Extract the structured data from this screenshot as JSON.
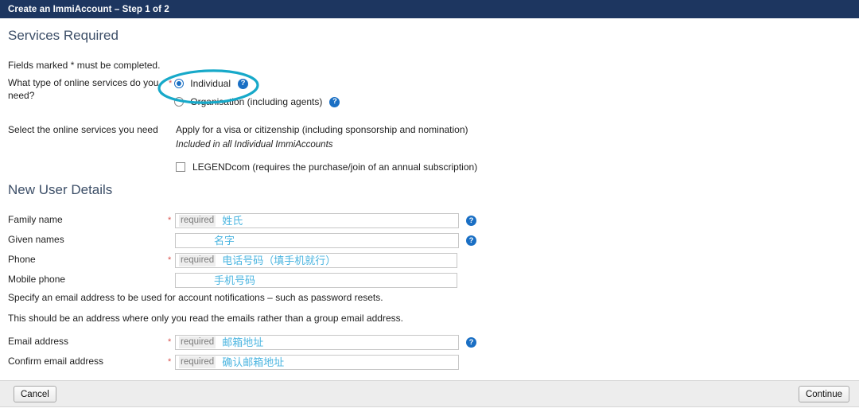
{
  "window": {
    "step_header": "Create an ImmiAccount – Step 1 of 2"
  },
  "services_section": {
    "heading": "Services Required",
    "fields_marked_note": "Fields marked * must be completed.",
    "service_type": {
      "label": "What type of online services do you need?",
      "required_star": "*",
      "options": [
        {
          "label": "Individual",
          "selected": true,
          "help": "?"
        },
        {
          "label": "Organisation (including agents)",
          "selected": false,
          "help": "?"
        }
      ]
    },
    "select_services": {
      "label": "Select the online services you need",
      "primary_service": "Apply for a visa or citizenship (including sponsorship and nomination)",
      "primary_note": "Included in all Individual ImmiAccounts",
      "checkbox": {
        "label": "LEGENDcom (requires the purchase/join of an annual subscription)",
        "checked": false
      }
    }
  },
  "user_section": {
    "heading": "New User Details",
    "required_tag": "required",
    "required_star": "*",
    "help": "?",
    "fields": [
      {
        "label": "Family name",
        "required": true,
        "placeholder": "required",
        "annotation": "姓氏",
        "has_help": true
      },
      {
        "label": "Given names",
        "required": false,
        "placeholder": "",
        "annotation": "名字",
        "has_help": true
      },
      {
        "label": "Phone",
        "required": true,
        "placeholder": "required",
        "annotation": "电话号码（填手机就行）",
        "has_help": false
      },
      {
        "label": "Mobile phone",
        "required": false,
        "placeholder": "",
        "annotation": "手机号码",
        "has_help": false
      },
      {
        "label": "Email address",
        "required": true,
        "placeholder": "required",
        "annotation": "邮箱地址",
        "has_help": true
      },
      {
        "label": "Confirm email address",
        "required": true,
        "placeholder": "required",
        "annotation": "确认邮箱地址",
        "has_help": false
      }
    ],
    "notes": [
      "Specify an email address to be used for account notifications – such as password resets.",
      "This should be an address where only you read the emails rather than a group email address."
    ]
  },
  "footer": {
    "cancel_label": "Cancel",
    "continue_label": "Continue"
  },
  "annotation": {
    "ellipse_color": "#17a9c9",
    "text_color": "#4bb5e0"
  },
  "colors": {
    "header_bg": "#1d3660",
    "heading_text": "#3d4f68",
    "required_star": "#d9534f",
    "help_icon": "#1a6fc4",
    "footer_bg": "#ededed"
  }
}
